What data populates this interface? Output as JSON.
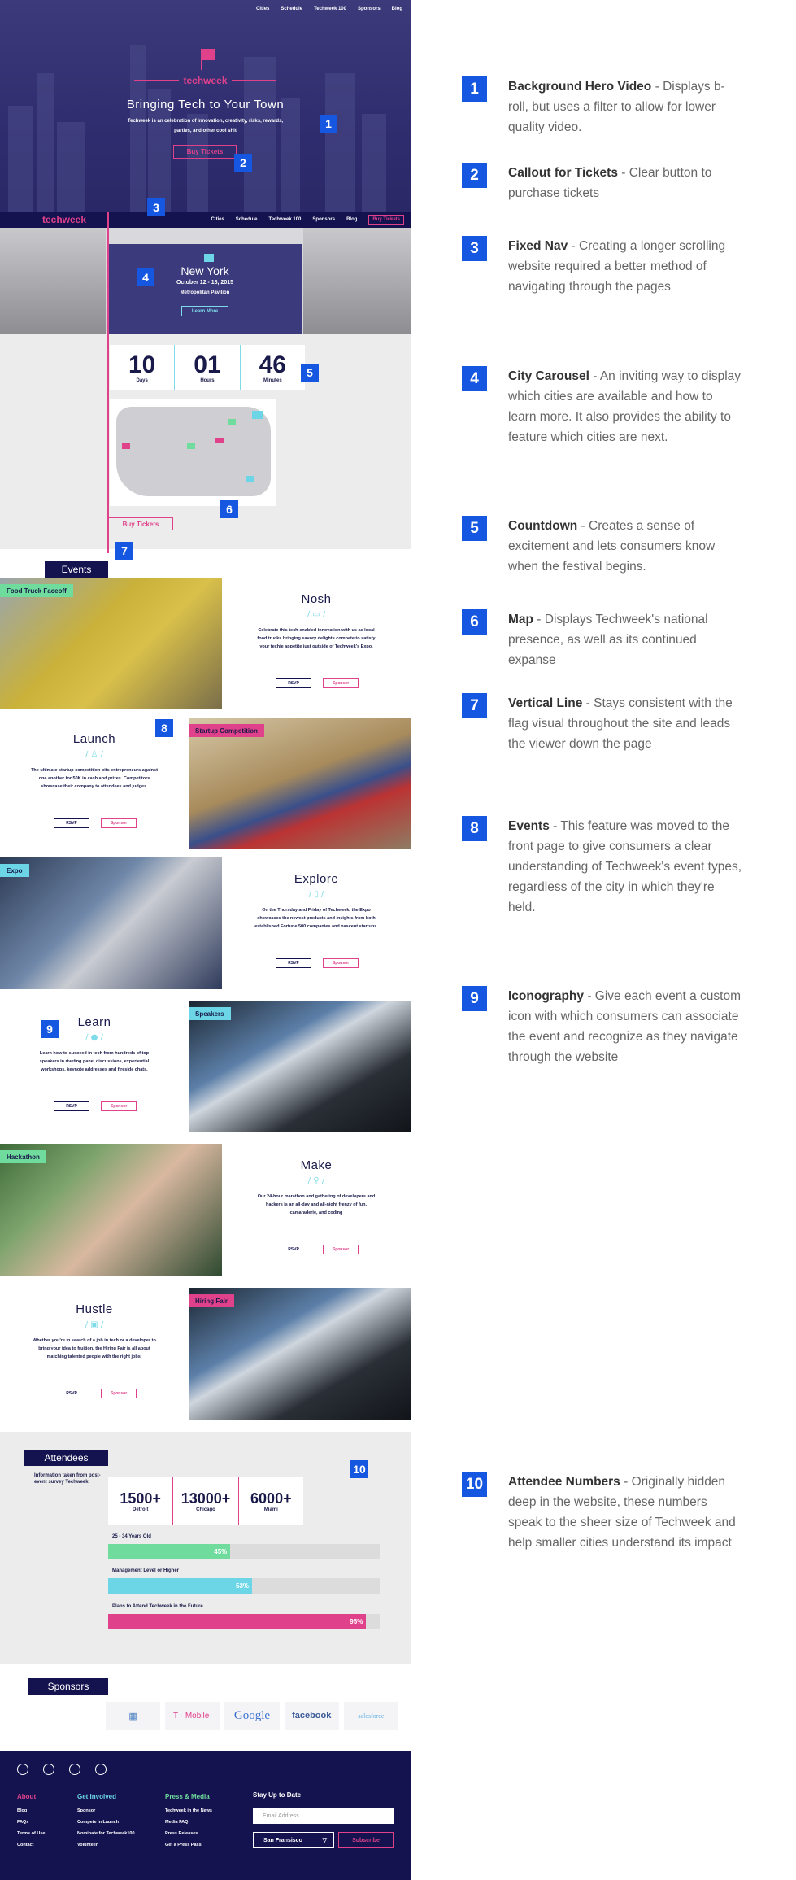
{
  "hero": {
    "nav": [
      "Cities",
      "Schedule",
      "Techweek 100",
      "Sponsors",
      "Blog"
    ],
    "logo": "techweek",
    "title": "Bringing Tech to Your Town",
    "subtitle": "Techweek is an celebration of innovation, creativity, risks, rewards, parties, and other cool shit",
    "cta": "Buy Tickets"
  },
  "fixed_nav": {
    "logo": "techweek",
    "links": [
      "Cities",
      "Schedule",
      "Techweek 100",
      "Sponsors",
      "Blog"
    ],
    "tickets": "Buy Tickets"
  },
  "carousel": {
    "city": "New York",
    "dates": "October 12 - 18, 2015",
    "venue": "Metropolitan Pavilion",
    "button": "Learn More"
  },
  "countdown": [
    {
      "value": "10",
      "label": "Days"
    },
    {
      "value": "01",
      "label": "Hours"
    },
    {
      "value": "46",
      "label": "Minutes"
    }
  ],
  "map_buy_tickets": "Buy Tickets",
  "events_heading": "Events",
  "events": [
    {
      "tag": "Food Truck Faceoff",
      "tag_color": "#6fdb9c",
      "name": "Nosh",
      "icon": "/ ▭ /",
      "desc": "Celebrate this tech-enabled innovation with us as local food trucks bringing savory delights compete to satisfy your techie appetite just outside of Techweek's Expo.",
      "rsvp": "RSVP",
      "sponsor": "Sponsor"
    },
    {
      "tag": "Startup Competition",
      "tag_color": "#e0418b",
      "name": "Launch",
      "icon": "/ ♙ /",
      "desc": "The ultimate startup competition pits entrepreneurs against one another for 50K in cash and prizes. Competitors showcase their company to attendees and judges.",
      "rsvp": "RSVP",
      "sponsor": "Sponsor"
    },
    {
      "tag": "Expo",
      "tag_color": "#6cd6e6",
      "name": "Explore",
      "icon": "/ ▯ /",
      "desc": "On the Thursday and Friday of Techweek, the Expo showcases the newest products and insights from both established Fortune 500 companies and nascent startups.",
      "rsvp": "RSVP",
      "sponsor": "Sponsor"
    },
    {
      "tag": "Speakers",
      "tag_color": "#6cd6e6",
      "name": "Learn",
      "icon": "/ ● /",
      "desc": "Learn how to succeed in tech from hundreds of top speakers in riveting panel discussions, experiential workshops, keynote addresses and fireside chats.",
      "rsvp": "RSVP",
      "sponsor": "Sponsor"
    },
    {
      "tag": "Hackathon",
      "tag_color": "#6fdb9c",
      "name": "Make",
      "icon": "/ ⚲ /",
      "desc": "Our 24-hour marathon and gathering of developers and hackers is an all-day and all-night frenzy of fun, camaraderie, and coding",
      "rsvp": "RSVP",
      "sponsor": "Sponsor"
    },
    {
      "tag": "Hiring Fair",
      "tag_color": "#e0418b",
      "name": "Hustle",
      "icon": "/ ▣ /",
      "desc": "Whether you're in search of a job in tech or a developer to bring your idea to fruition, the Hiring Fair is all about matching talented people with the right jobs.",
      "rsvp": "RSVP",
      "sponsor": "Sponsor"
    }
  ],
  "attendees": {
    "heading": "Attendees",
    "note": "Information taken from post-event survey Techweek",
    "stats": [
      {
        "value": "1500+",
        "city": "Detroit"
      },
      {
        "value": "13000+",
        "city": "Chicago"
      },
      {
        "value": "6000+",
        "city": "Miami"
      }
    ],
    "bars": [
      {
        "label": "25 - 34 Years Old",
        "percent": 45,
        "text": "45%",
        "color": "#6fdb9c"
      },
      {
        "label": "Management Level or Higher",
        "percent": 53,
        "text": "53%",
        "color": "#6cd6e6"
      },
      {
        "label": "Plans to Attend Techweek in the Future",
        "percent": 95,
        "text": "95%",
        "color": "#e0418b"
      }
    ]
  },
  "sponsors": {
    "heading": "Sponsors",
    "logos": [
      "▦",
      "T · Mobile·",
      "Google",
      "facebook",
      "salesforce"
    ]
  },
  "footer": {
    "columns": [
      {
        "heading": "About",
        "color": "#e0418b",
        "items": [
          "Blog",
          "FAQs",
          "Terms of Use",
          "Contact"
        ]
      },
      {
        "heading": "Get Involved",
        "color": "#6cd6e6",
        "items": [
          "Sponsor",
          "Compete in Launch",
          "Nominate for Techweek100",
          "Volunteer"
        ]
      },
      {
        "heading": "Press & Media",
        "color": "#6fdb9c",
        "items": [
          "Techweek in the News",
          "Media FAQ",
          "Press Releases",
          "Get a Press Pass"
        ]
      }
    ],
    "stay": "Stay Up to Date",
    "email_placeholder": "Email Address",
    "city": "San Fransisco",
    "subscribe": "Subscribe"
  },
  "badges": [
    "1",
    "2",
    "3",
    "4",
    "5",
    "6",
    "7",
    "8",
    "9",
    "10"
  ],
  "annotations": [
    {
      "num": "1",
      "title": "Background Hero Video",
      "body": "Displays b-roll, but uses a filter to allow for lower quality video."
    },
    {
      "num": "2",
      "title": "Callout for Tickets",
      "body": "Clear button to purchase tickets"
    },
    {
      "num": "3",
      "title": "Fixed Nav",
      "body": "Creating a longer scrolling website required a better method of navigating through the pages"
    },
    {
      "num": "4",
      "title": "City Carousel",
      "body": "An inviting way to display which cities are available and how to learn more. It also provides the ability to feature which cities are next."
    },
    {
      "num": "5",
      "title": "Countdown",
      "body": "Creates a sense of excitement and lets consumers know when the festival begins."
    },
    {
      "num": "6",
      "title": "Map",
      "body": "Displays Techweek's national presence, as well as its continued expanse"
    },
    {
      "num": "7",
      "title": "Vertical Line",
      "body": "Stays consistent with the flag visual throughout the site and leads the viewer down the page"
    },
    {
      "num": "8",
      "title": "Events",
      "body": "This feature was moved to the front page to give consumers a clear understanding of Techweek's event types, regardless of the city in which they're held."
    },
    {
      "num": "9",
      "title": "Iconography",
      "body": "Give each event a custom icon with which consumers can associate the event and recognize as they navigate through the website"
    },
    {
      "num": "10",
      "title": "Attendee Numbers",
      "body": "Originally hidden deep in the website, these numbers speak to the sheer size of Techweek and help smaller cities understand its impact"
    }
  ]
}
